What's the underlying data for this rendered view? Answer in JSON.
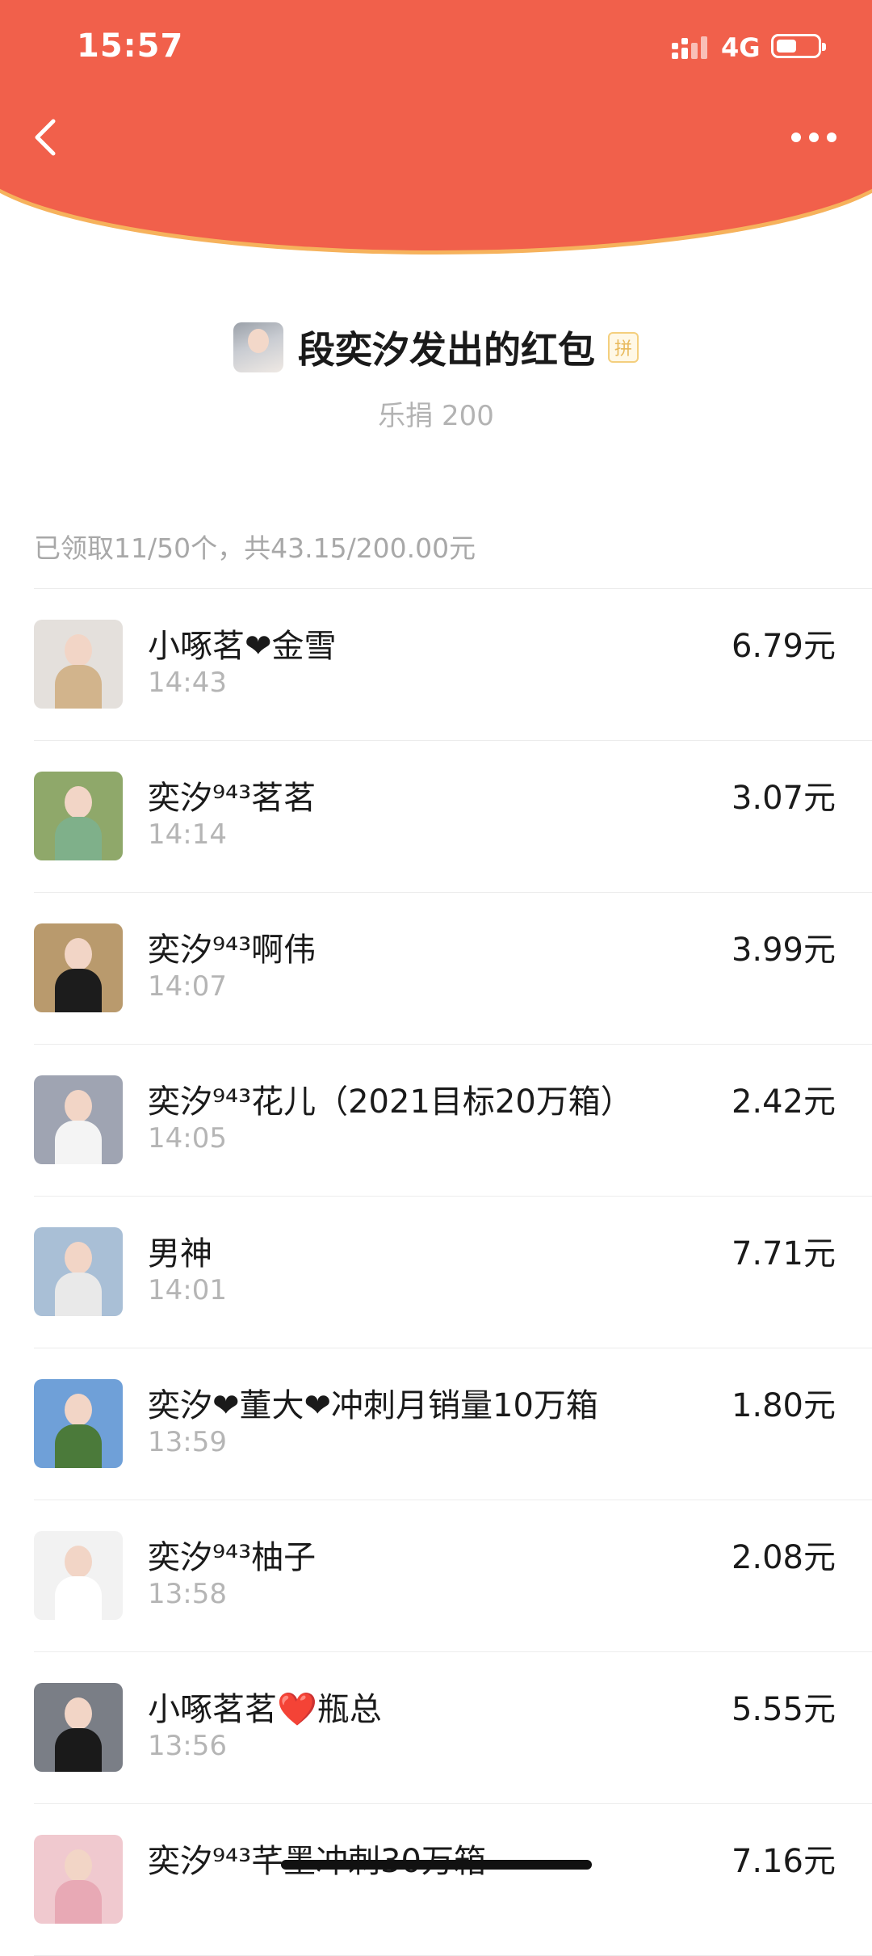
{
  "status_bar": {
    "time": "15:57",
    "network": "4G"
  },
  "header": {
    "back_icon": "chevron-left-icon",
    "more_icon": "more-dots-icon",
    "color": "#f1604b"
  },
  "sender": {
    "title": "段奕汐发出的红包",
    "badge": "拼",
    "subtitle": "乐捐 200"
  },
  "summary": "已领取11/50个，共43.15/200.00元",
  "records": [
    {
      "name": "小啄茗❤金雪",
      "time": "14:43",
      "amount": "6.79元",
      "avatar_bg": "#e4e0dc",
      "avatar_body": "#d2b48c"
    },
    {
      "name": "奕汐⁹⁴³茗茗",
      "time": "14:14",
      "amount": "3.07元",
      "avatar_bg": "#8fa86a",
      "avatar_body": "#7fb08a"
    },
    {
      "name": "奕汐⁹⁴³啊伟",
      "time": "14:07",
      "amount": "3.99元",
      "avatar_bg": "#b99a6d",
      "avatar_body": "#1c1c1c"
    },
    {
      "name": "奕汐⁹⁴³花儿（2021目标20万箱）",
      "time": "14:05",
      "amount": "2.42元",
      "avatar_bg": "#9fa4b2",
      "avatar_body": "#f4f4f4"
    },
    {
      "name": "男神",
      "time": "14:01",
      "amount": "7.71元",
      "avatar_bg": "#a9bfd6",
      "avatar_body": "#e9e9e9"
    },
    {
      "name": "奕汐❤董大❤冲刺月销量10万箱",
      "time": "13:59",
      "amount": "1.80元",
      "avatar_bg": "#6fa0d8",
      "avatar_body": "#4b7a3a"
    },
    {
      "name": "奕汐⁹⁴³柚子",
      "time": "13:58",
      "amount": "2.08元",
      "avatar_bg": "#f2f2f2",
      "avatar_body": "#ffffff"
    },
    {
      "name": "小啄茗茗❤️瓶总",
      "time": "13:56",
      "amount": "5.55元",
      "avatar_bg": "#7a7e86",
      "avatar_body": "#1a1a1a"
    },
    {
      "name": "奕汐⁹⁴³芊墨冲刺30万箱",
      "time": "",
      "amount": "7.16元",
      "avatar_bg": "#f0c9cf",
      "avatar_body": "#e8a9b5"
    }
  ]
}
